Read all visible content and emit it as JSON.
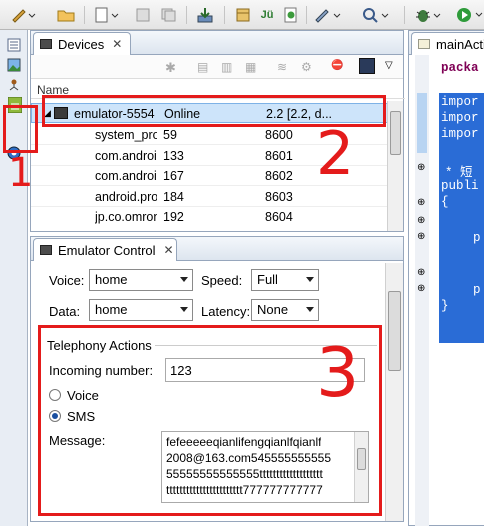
{
  "toolbar": {
    "icons": [
      "pen-icon",
      "folder-open-icon",
      "new-icon",
      "save-icon",
      "save-all-icon",
      "download-icon",
      "package-icon",
      "junit-icon",
      "new-class-icon",
      "pen-down-icon",
      "search-icon",
      "bug-icon",
      "run-icon"
    ]
  },
  "sidebar": {
    "icons": [
      "package-explorer-icon",
      "image-icon",
      "hierarchy-icon",
      "android-icon",
      "ddms-icon"
    ]
  },
  "devices": {
    "tab_label": "Devices",
    "column_name": "Name",
    "rows": [
      {
        "name": "emulator-5554",
        "status": "Online",
        "extra": "2.2 [2.2, d..."
      },
      {
        "name": "system_process",
        "status": "59",
        "extra": "8600"
      },
      {
        "name": "com.android.phone",
        "status": "133",
        "extra": "8601"
      },
      {
        "name": "com.android.launcher",
        "status": "167",
        "extra": "8602"
      },
      {
        "name": "android.process.acore",
        "status": "184",
        "extra": "8603"
      },
      {
        "name": "jp.co.omronsoft.openwnn",
        "status": "192",
        "extra": "8604"
      }
    ]
  },
  "emulator_control": {
    "tab_label": "Emulator Control",
    "voice_label": "Voice:",
    "voice_value": "home",
    "speed_label": "Speed:",
    "speed_value": "Full",
    "data_label": "Data:",
    "data_value": "home",
    "latency_label": "Latency:",
    "latency_value": "None",
    "telephony_title": "Telephony Actions",
    "incoming_label": "Incoming number:",
    "incoming_value": "123",
    "voice_radio": "Voice",
    "sms_radio": "SMS",
    "message_label": "Message:",
    "message_lines": [
      "fefeeeeeqianlifengqianlfqianlf",
      "2008@163.com545555555555",
      "55555555555555ttttttttttttttttttt",
      "ttttttttttttttttttttttt777777777777"
    ]
  },
  "editor": {
    "tab_label": "mainActi",
    "lines": [
      "packa",
      "",
      "impor",
      "impor",
      "impor",
      "",
      "* 短",
      "publi",
      "{",
      "",
      "p",
      "",
      "",
      "p",
      "}"
    ]
  },
  "annotations": {
    "n1": "1",
    "n2": "2",
    "n3": "3"
  },
  "colors": {
    "annotation_red": "#e41b1b",
    "selection_blue": "#cde4fa",
    "code_keyword": "#7f0055"
  }
}
